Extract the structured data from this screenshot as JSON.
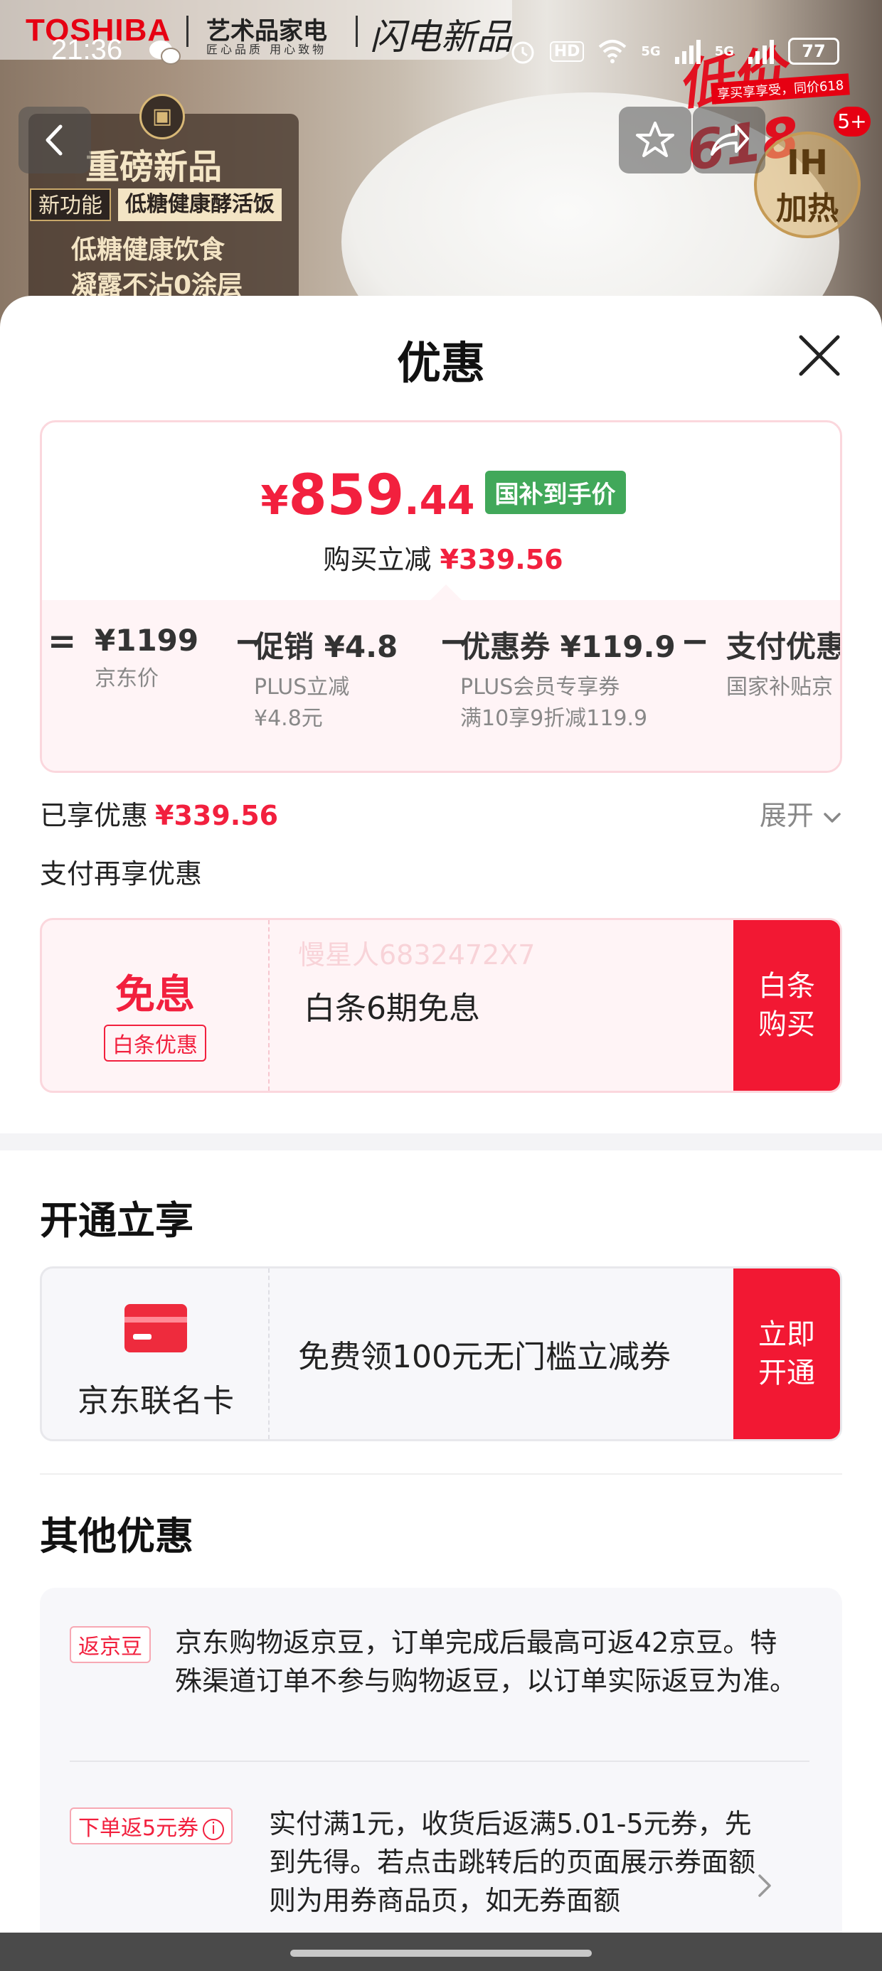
{
  "status_bar": {
    "time": "21:36",
    "hd_label": "HD",
    "signal1": "5G",
    "signal2": "5G",
    "battery": "77"
  },
  "banner": {
    "brand": "TOSHIBA",
    "brand_sub": "艺术品家电",
    "brand_sub2": "匠心品质 用心致物",
    "slogan": "闪电新品",
    "new_title": "重磅新品",
    "new_tag1": "新功能",
    "new_tag2": "低糖健康酵活饭",
    "new_line1": "低糖健康饮食",
    "new_line2": "凝露不沾0涂层",
    "promo": "低价618",
    "promo_sub": "享买享享受，同价618",
    "badge_count": "5+",
    "ih_label": "IH",
    "ih_sub": "加热"
  },
  "sheet": {
    "title": "优惠",
    "price": {
      "currency": "¥",
      "integer": "859",
      "decimal": ".44",
      "tag": "国补到手价",
      "reduce_label": "购买立减",
      "reduce_value": "¥339.56"
    },
    "breakdown": [
      {
        "op": "=",
        "title": "¥1199",
        "sub1": "京东价",
        "sub2": ""
      },
      {
        "op": "−",
        "title": "促销 ¥4.8",
        "sub1": "PLUS立减",
        "sub2": "¥4.8元"
      },
      {
        "op": "−",
        "title": "优惠券 ¥119.9",
        "sub1": "PLUS会员专享券",
        "sub2": "满10享9折减119.9"
      },
      {
        "op": "−",
        "title": "支付优惠",
        "sub1": "国家补贴京",
        "sub2": ""
      }
    ],
    "enjoyed_label": "已享优惠",
    "enjoyed_value": "¥339.56",
    "expand_label": "展开",
    "pay_more": "支付再享优惠",
    "baitiao": {
      "big": "免息",
      "tag": "白条优惠",
      "watermark": "慢星人6832472X7",
      "text": "白条6期免息",
      "button": "白条\n购买"
    },
    "open_title": "开通立享",
    "lianming": {
      "name": "京东联名卡",
      "text": "免费领100元无门槛立减券",
      "button": "立即\n开通"
    },
    "other_title": "其他优惠",
    "offers": [
      {
        "tag": "返京豆",
        "text": "京东购物返京豆，订单完成后最高可返42京豆。特殊渠道订单不参与购物返豆，以订单实际返豆为准。"
      },
      {
        "tag": "下单返5元券",
        "info": "i",
        "text": "实付满1元，收货后返满5.01-5元券，先到先得。若点击跳转后的页面展示券面额则为用券商品页，如无券面额"
      }
    ]
  },
  "colors": {
    "accent_red": "#f2203e",
    "button_red": "#f21833",
    "tag_green": "#41a85a"
  }
}
